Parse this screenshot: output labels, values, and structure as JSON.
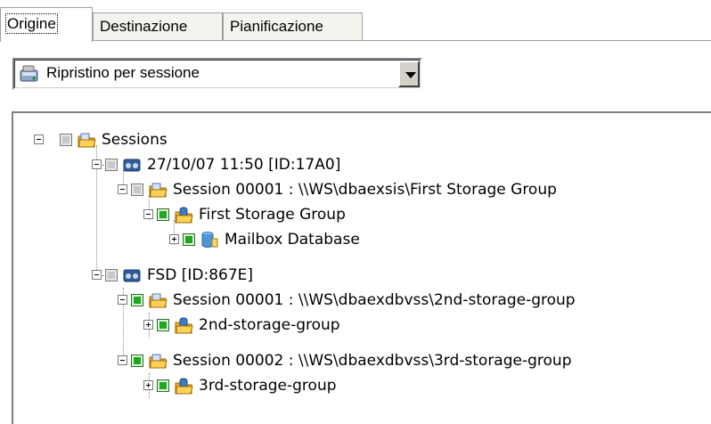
{
  "tabs": [
    {
      "label": "Origine",
      "active": true
    },
    {
      "label": "Destinazione",
      "active": false
    },
    {
      "label": "Pianificazione",
      "active": false
    }
  ],
  "restore_mode": {
    "selected": "Ripristino per sessione",
    "icon": "restore-disk-icon"
  },
  "tree": {
    "root": {
      "label": "Sessions",
      "icon": "folder-sessions-icon"
    },
    "nodes": [
      {
        "label": "27/10/07 11:50 [ID:17A0]",
        "icon": "tape-icon"
      },
      {
        "label": "Session 00001 : \\\\WS\\dbaexsis\\First Storage Group",
        "icon": "session-folder-icon"
      },
      {
        "label": "First Storage Group",
        "icon": "storage-group-icon"
      },
      {
        "label": "Mailbox Database",
        "icon": "database-icon"
      },
      {
        "label": "FSD [ID:867E]",
        "icon": "tape-icon"
      },
      {
        "label": "Session 00001 : \\\\WS\\dbaexdbvss\\2nd-storage-group",
        "icon": "session-folder-icon"
      },
      {
        "label": "2nd-storage-group",
        "icon": "storage-group-icon"
      },
      {
        "label": "Session 00002 : \\\\WS\\dbaexdbvss\\3rd-storage-group",
        "icon": "session-folder-icon"
      },
      {
        "label": "3rd-storage-group",
        "icon": "storage-group-icon"
      }
    ]
  },
  "colors": {
    "checkbox_green": "#1ea81e",
    "checkbox_gray": "#c8c8c8"
  }
}
